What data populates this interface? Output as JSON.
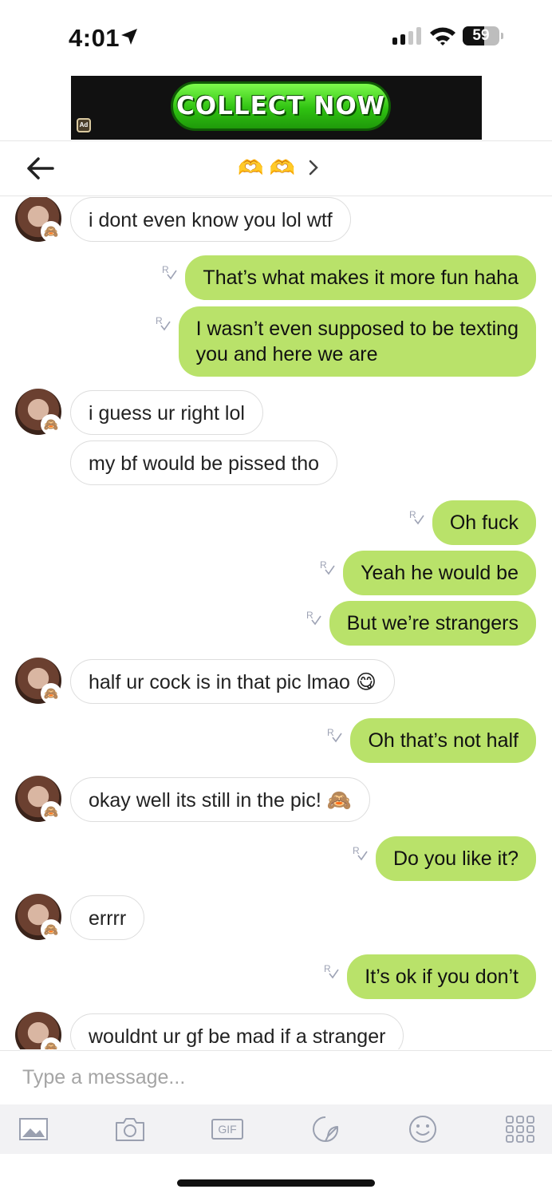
{
  "status_bar": {
    "time": "4:01",
    "battery": "59",
    "battery_level": 0.59
  },
  "ad": {
    "cta": "COLLECT NOW",
    "badge": "Ad",
    "button_color": "#2fc211"
  },
  "header": {
    "title": "🫶 🫶",
    "back_icon": "arrow-left-icon",
    "chevron_icon": "chevron-right-icon"
  },
  "colors": {
    "outgoing_bubble": "#b9e26a",
    "incoming_bubble": "#ffffff",
    "incoming_border": "#dddddd",
    "receipt": "#9ea3b5"
  },
  "avatar_badge": "🙈",
  "messages": [
    {
      "side": "in",
      "text": "i dont even know you lol wtf"
    },
    {
      "side": "out",
      "text": "That’s what makes it more fun haha"
    },
    {
      "side": "out",
      "text": "I wasn’t even supposed to be texting\nyou and here we are"
    },
    {
      "side": "in",
      "text": "i guess ur right lol"
    },
    {
      "side": "in",
      "text": "my bf would be pissed tho"
    },
    {
      "side": "out",
      "text": "Oh fuck"
    },
    {
      "side": "out",
      "text": "Yeah he would be"
    },
    {
      "side": "out",
      "text": "But we’re strangers"
    },
    {
      "side": "in",
      "text": "half ur cock is in that pic lmao 😋"
    },
    {
      "side": "out",
      "text": "Oh that’s not half"
    },
    {
      "side": "in",
      "text": "okay well its still in the pic! 🙈"
    },
    {
      "side": "out",
      "text": "Do you like it?"
    },
    {
      "side": "in",
      "text": "errrr"
    },
    {
      "side": "out",
      "text": "It’s ok if you don’t"
    },
    {
      "side": "in",
      "text": "wouldnt ur gf be mad if a stranger"
    }
  ],
  "composer": {
    "placeholder": "Type a message..."
  },
  "toolbar": {
    "items": [
      "image-icon",
      "camera-icon",
      "gif-icon",
      "sticker-icon",
      "emoji-icon",
      "apps-grid-icon"
    ],
    "gif_label": "GIF"
  }
}
